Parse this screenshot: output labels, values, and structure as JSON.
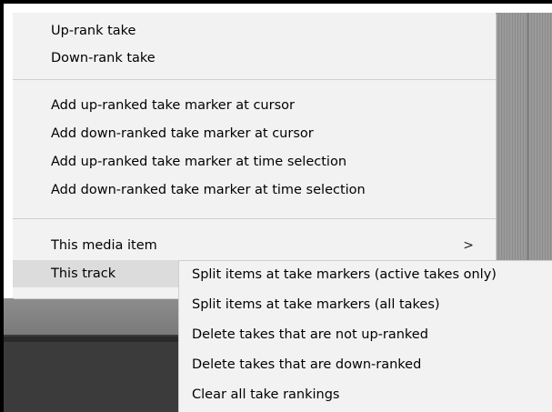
{
  "context_menu": {
    "items": [
      {
        "label": "Up-rank take"
      },
      {
        "label": "Down-rank take"
      },
      {
        "label": "Add up-ranked take marker at cursor"
      },
      {
        "label": "Add down-ranked take marker at cursor"
      },
      {
        "label": "Add up-ranked take marker at time selection"
      },
      {
        "label": "Add down-ranked take marker at time selection"
      },
      {
        "label": "This media item",
        "submenu_arrow": ">"
      },
      {
        "label": "This track"
      }
    ]
  },
  "submenu": {
    "items": [
      {
        "label": "Split items at take markers (active takes only)"
      },
      {
        "label": "Split items at take markers (all takes)"
      },
      {
        "label": "Delete takes that are not up-ranked"
      },
      {
        "label": "Delete takes that are down-ranked"
      },
      {
        "label": "Clear all take rankings"
      }
    ]
  }
}
